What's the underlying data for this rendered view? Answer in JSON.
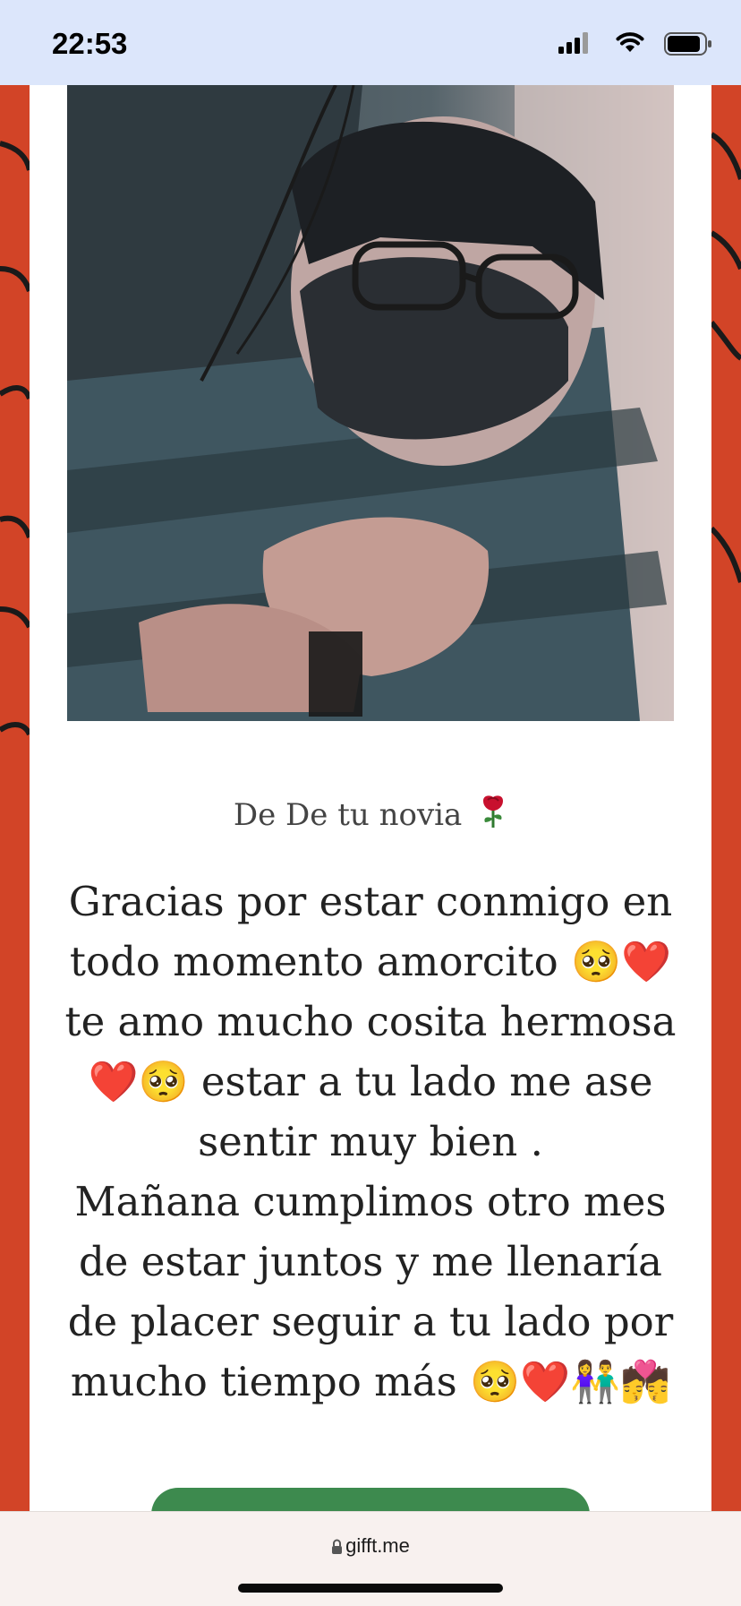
{
  "status_bar": {
    "time": "22:53",
    "icons": [
      "signal-icon",
      "wifi-icon",
      "battery-icon"
    ]
  },
  "card": {
    "photo_icon": "couple-photo",
    "from_line": "De De tu novia",
    "from_icon": "rose-icon",
    "message_lines": [
      "Gracias por estar conmigo en",
      "todo momento amorcito 🥺❤️",
      "te amo mucho cosita hermosa",
      "❤️🥺 estar a tu lado me ase",
      "sentir muy bien .",
      "Mañana cumplimos otro mes",
      "de estar juntos y me llenaría",
      "de placer seguir a tu lado por",
      "mucho tiempo más 🥺❤️👫💏"
    ]
  },
  "browser": {
    "url": "gifft.me",
    "lock_icon": "lock-icon"
  },
  "colors": {
    "background": "#d24427",
    "card": "#ffffff",
    "button": "#3d8a4e",
    "status_bar": "#dce6fb"
  }
}
